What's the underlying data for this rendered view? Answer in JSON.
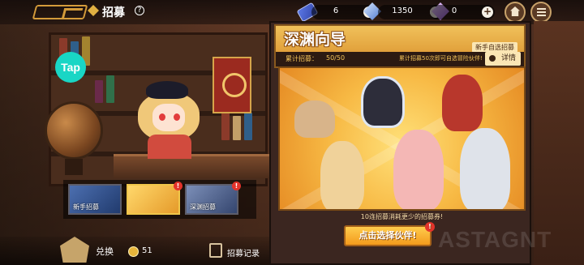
{
  "header": {
    "title": "招募",
    "help_label": "?"
  },
  "resources": [
    {
      "icon": "ticket-icon",
      "value": "6",
      "plus": "+"
    },
    {
      "icon": "blue-crystal-icon",
      "value": "1350",
      "plus": "+"
    },
    {
      "icon": "purple-crystal-icon",
      "value": "0",
      "plus": "+"
    }
  ],
  "tap_badge": "Tap",
  "banner_thumbs": [
    {
      "label": "新手招募",
      "active": false
    },
    {
      "label": "",
      "active": true,
      "alert": "!"
    },
    {
      "label": "深渊招募",
      "active": false,
      "alert": "!"
    }
  ],
  "bottom": {
    "exchange_label": "兑换",
    "coin_value": "51",
    "record_label": "招募记录"
  },
  "panel": {
    "title": "深渊向导",
    "subtitle": "新手自选招募",
    "progress_label": "累计招募：",
    "progress_value": "50/50",
    "note": "累计招募50次即可自选冒险伙伴!",
    "detail_label": "详情",
    "caption": "10连招募消耗更少的招募券!",
    "recruit_label": "点击选择伙伴!",
    "recruit_alert": "!"
  },
  "colors": {
    "accent": "#f0c15a",
    "tap": "#19d6c5",
    "alert": "#e2332b"
  }
}
